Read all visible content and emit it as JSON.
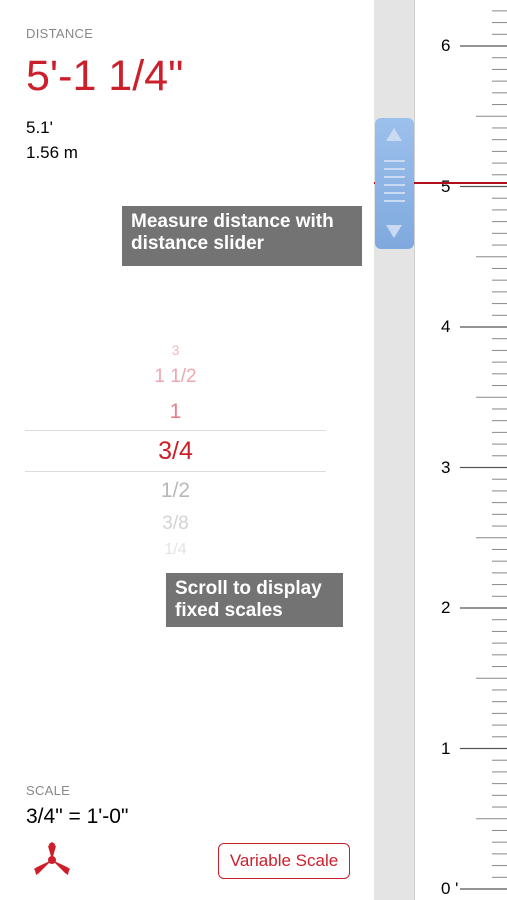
{
  "distance": {
    "label": "DISTANCE",
    "value": "5'-1 1/4\"",
    "feet_decimal": "5.1'",
    "meters": "1.56 m"
  },
  "tooltips": {
    "slider": "Measure distance with distance slider",
    "scroll": "Scroll to display fixed scales"
  },
  "picker": {
    "items": [
      "3",
      "1 1/2",
      "1",
      "3/4",
      "1/2",
      "3/8",
      "1/4"
    ],
    "selected": "3/4"
  },
  "scale": {
    "label": "SCALE",
    "value": "3/4\" = 1'-0\""
  },
  "buttons": {
    "variable_scale": "Variable Scale"
  },
  "ruler": {
    "labels": [
      "6",
      "5",
      "4",
      "3",
      "2",
      "1",
      "0 '"
    ]
  },
  "icons": {
    "logo": "tri-blade-logo-icon",
    "slider_up": "triangle-up-icon",
    "slider_down": "triangle-down-icon",
    "slider_grip": "grip-lines-icon"
  },
  "colors": {
    "accent": "#cc1f2b",
    "slider": "#8bb3e4",
    "tooltip": "#737373"
  }
}
